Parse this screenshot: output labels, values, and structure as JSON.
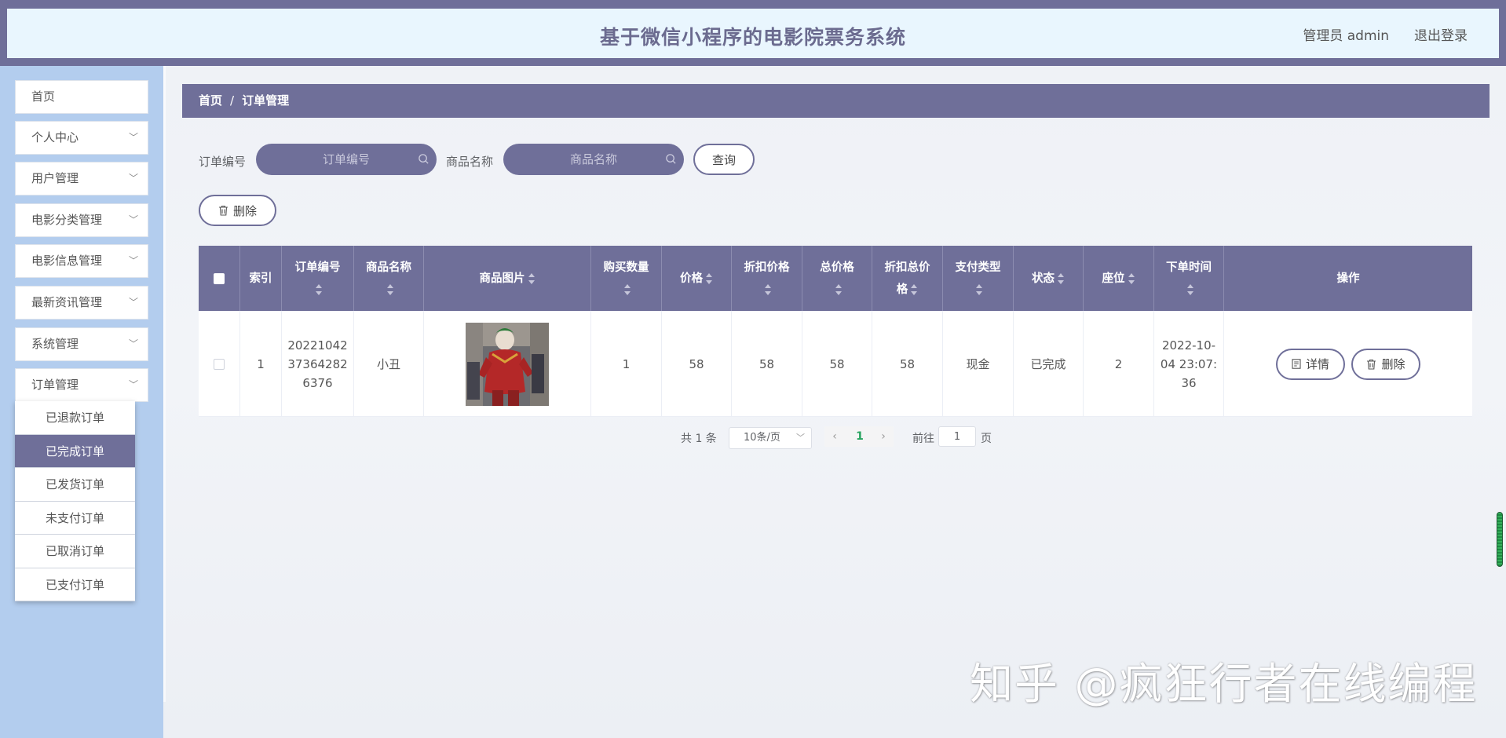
{
  "header": {
    "title": "基于微信小程序的电影院票务系统",
    "admin": "管理员 admin",
    "logout": "退出登录"
  },
  "sidebar": {
    "items": [
      {
        "label": "首页",
        "has_arrow": false
      },
      {
        "label": "个人中心",
        "has_arrow": true
      },
      {
        "label": "用户管理",
        "has_arrow": true
      },
      {
        "label": "电影分类管理",
        "has_arrow": true
      },
      {
        "label": "电影信息管理",
        "has_arrow": true
      },
      {
        "label": "最新资讯管理",
        "has_arrow": true
      },
      {
        "label": "系统管理",
        "has_arrow": true
      },
      {
        "label": "订单管理",
        "has_arrow": true
      }
    ],
    "submenu": [
      {
        "label": "已退款订单",
        "active": false
      },
      {
        "label": "已完成订单",
        "active": true
      },
      {
        "label": "已发货订单",
        "active": false
      },
      {
        "label": "未支付订单",
        "active": false
      },
      {
        "label": "已取消订单",
        "active": false
      },
      {
        "label": "已支付订单",
        "active": false
      }
    ]
  },
  "breadcrumb": {
    "home": "首页",
    "separator": "/",
    "current": "订单管理"
  },
  "search": {
    "order_label": "订单编号",
    "order_placeholder": "订单编号",
    "product_label": "商品名称",
    "product_placeholder": "商品名称",
    "query_button": "查询",
    "delete_button": "删除"
  },
  "table": {
    "columns": [
      {
        "label": "",
        "sortable": false
      },
      {
        "label": "索引",
        "sortable": false
      },
      {
        "label": "订单编号",
        "sortable": true
      },
      {
        "label": "商品名称",
        "sortable": true
      },
      {
        "label": "商品图片",
        "sortable": true
      },
      {
        "label": "购买数量",
        "sortable": true
      },
      {
        "label": "价格",
        "sortable": true
      },
      {
        "label": "折扣价格",
        "sortable": true
      },
      {
        "label": "总价格",
        "sortable": true
      },
      {
        "label": "折扣总价格",
        "sortable": true
      },
      {
        "label": "支付类型",
        "sortable": true
      },
      {
        "label": "状态",
        "sortable": true
      },
      {
        "label": "座位",
        "sortable": true
      },
      {
        "label": "下单时间",
        "sortable": true
      },
      {
        "label": "操作",
        "sortable": false
      }
    ],
    "rows": [
      {
        "index": "1",
        "order_no": "20221042373642826376",
        "product_name": "小丑",
        "quantity": "1",
        "price": "58",
        "discount_price": "58",
        "total_price": "58",
        "discount_total": "58",
        "pay_type": "现金",
        "status": "已完成",
        "seat": "2",
        "order_time": "2022-10-04 23:07:36",
        "detail_button": "详情",
        "delete_button": "删除"
      }
    ]
  },
  "pagination": {
    "total": "共 1 条",
    "page_size": "10条/页",
    "current_page": "1",
    "goto_label": "前往",
    "goto_value": "1",
    "page_suffix": "页"
  },
  "watermark": "知乎 @疯狂行者在线编程",
  "colors": {
    "accent": "#6f6f99",
    "sidebar": "#b3cdee",
    "header_bg": "#e9f6fe",
    "page_active": "#27a35f"
  }
}
